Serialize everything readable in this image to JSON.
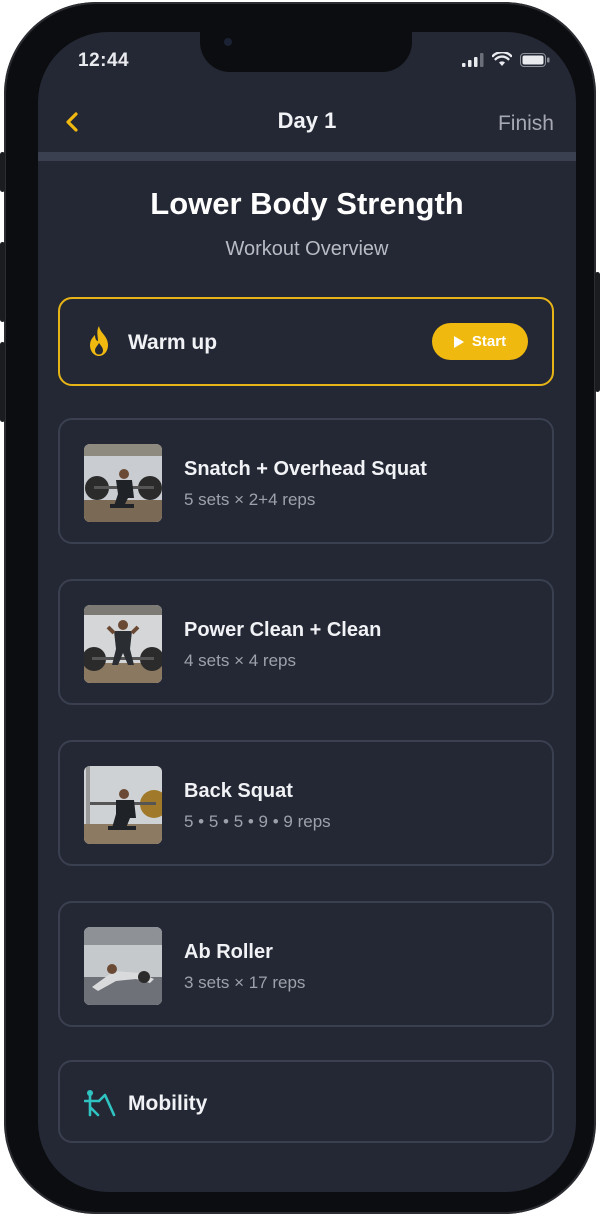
{
  "status_bar": {
    "time": "12:44"
  },
  "nav": {
    "title": "Day 1",
    "finish_label": "Finish"
  },
  "workout": {
    "title": "Lower Body Strength",
    "subtitle": "Workout Overview"
  },
  "warmup": {
    "label": "Warm up",
    "start_label": "Start",
    "icon": "flame-icon"
  },
  "exercises": [
    {
      "name": "Snatch + Overhead Squat",
      "detail": "5 sets × 2+4 reps"
    },
    {
      "name": "Power Clean + Clean",
      "detail": "4 sets × 4 reps"
    },
    {
      "name": "Back Squat",
      "detail": "5 • 5 • 5 • 9 • 9 reps"
    },
    {
      "name": "Ab Roller",
      "detail": "3 sets × 17 reps"
    }
  ],
  "mobility": {
    "label": "Mobility",
    "icon": "mobility-stretch-icon"
  },
  "colors": {
    "background": "#242834",
    "accent": "#f0b90f",
    "mobility_accent": "#2fc4c2",
    "card_border": "#3a4050"
  }
}
